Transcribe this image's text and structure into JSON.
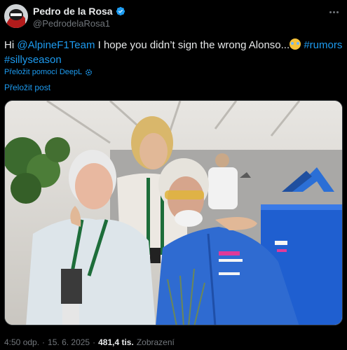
{
  "author": {
    "display_name": "Pedro de la Rosa",
    "handle": "@PedrodelaRosa1",
    "verified_color": "#1d9bf0"
  },
  "tweet": {
    "text_intro": "Hi ",
    "mention": "@AlpineF1Team",
    "text_body": " I hope you didn’t sign the wrong Alonso...",
    "hashtag_1": "#rumors",
    "hashtag_2": "#sillyseason",
    "emoji": "face-with-tears-of-joy"
  },
  "actions": {
    "translate_deepl": "Přeložit pomocí DeepL",
    "translate_post": "Přeložit post"
  },
  "meta": {
    "time": "4:50 odp.",
    "separator_1": "·",
    "date": "15. 6. 2025",
    "separator_2": "·",
    "views_count": "481,4 tis.",
    "views_label": "Zobrazení"
  },
  "colors": {
    "background": "#000000",
    "text": "#e7e9ea",
    "secondary": "#71767b",
    "link": "#1d9bf0",
    "alpine_blue": "#2b6fd6"
  }
}
